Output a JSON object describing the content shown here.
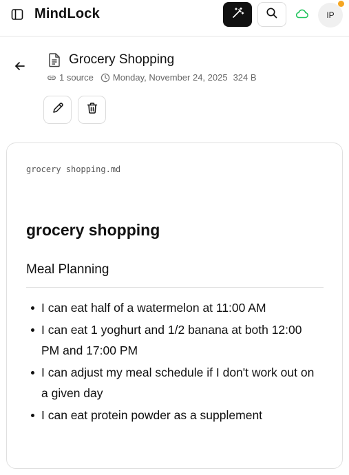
{
  "app": {
    "title": "MindLock"
  },
  "header": {
    "avatar_initials": "IP",
    "status_dot_color": "#f5a623",
    "cloud_color": "#22c55e"
  },
  "note": {
    "title": "Grocery Shopping",
    "sources": "1 source",
    "date": "Monday, November 24, 2025",
    "size": "324 B"
  },
  "content": {
    "filename": "grocery shopping.md",
    "heading": "grocery shopping",
    "section_title": "Meal Planning",
    "items": [
      "I can eat half of a watermelon at 11:00 AM",
      "I can eat 1 yoghurt and 1/2 banana at both 12:00 PM and 17:00 PM",
      "I can adjust my meal schedule if I don't work out on a given day",
      "I can eat protein powder as a supplement"
    ]
  }
}
